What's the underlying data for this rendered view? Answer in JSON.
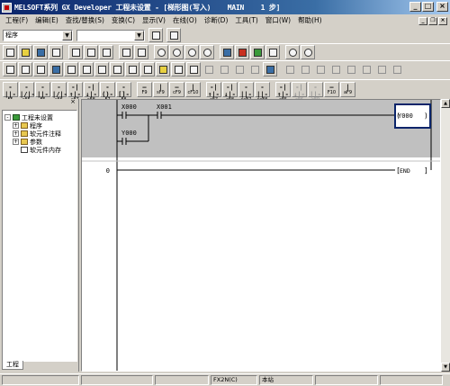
{
  "window": {
    "title": "MELSOFT系列 GX Developer 工程未设置 - [梯形图(写入)    MAIN    1 步]",
    "min_label": "_",
    "max_label": "□",
    "close_label": "×"
  },
  "menu": {
    "items": [
      "工程(F)",
      "编辑(E)",
      "查找/替换(S)",
      "变换(C)",
      "显示(V)",
      "在线(O)",
      "诊断(D)",
      "工具(T)",
      "窗口(W)",
      "帮助(H)"
    ],
    "mdi_min": "_",
    "mdi_restore": "❐",
    "mdi_close": "×"
  },
  "combo": {
    "program_value": "程序",
    "second_value": "",
    "arrow": "▼"
  },
  "ladder_toolbar": [
    {
      "sym": "-||-",
      "fk": "F5",
      "enabled": true
    },
    {
      "sym": "-|/|-",
      "fk": "sF5",
      "enabled": true
    },
    {
      "sym": "-||-",
      "fk": "F6",
      "enabled": true
    },
    {
      "sym": "-|/|-",
      "fk": "sF6",
      "enabled": true
    },
    {
      "sym": "-|↑|-",
      "fk": "sF7",
      "enabled": true
    },
    {
      "sym": "-|↓|-",
      "fk": "sF8",
      "enabled": true
    },
    {
      "sym": "-()-",
      "fk": "F7",
      "enabled": true
    },
    {
      "sym": "-[]-",
      "fk": "F8",
      "enabled": true
    },
    {
      "sym": "—",
      "fk": "F9",
      "enabled": true
    },
    {
      "sym": "|",
      "fk": "sF9",
      "enabled": true
    },
    {
      "sym": "—",
      "fk": "cF9",
      "enabled": true
    },
    {
      "sym": "|",
      "fk": "cF10",
      "enabled": true
    },
    {
      "sym": "-|↑|-",
      "fk": "aF7",
      "enabled": true
    },
    {
      "sym": "-|↓|-",
      "fk": "aF8",
      "enabled": true
    },
    {
      "sym": "-||-",
      "fk": "saF7",
      "enabled": true
    },
    {
      "sym": "-||-",
      "fk": "saF8",
      "enabled": true
    },
    {
      "sym": "-|↑|-",
      "fk": "aF5",
      "enabled": true
    },
    {
      "sym": "-|↓|-",
      "fk": "aF6",
      "enabled": false
    },
    {
      "sym": "-||-",
      "fk": "aF9",
      "enabled": false
    },
    {
      "sym": "—",
      "fk": "F10",
      "enabled": true
    },
    {
      "sym": "|",
      "fk": "aF9",
      "enabled": true
    }
  ],
  "project_tree": {
    "close_label": "×",
    "items": [
      {
        "label": "工程未设置",
        "expander": "-",
        "icon": "project",
        "indent": 0
      },
      {
        "label": "程序",
        "expander": "+",
        "icon": "folder",
        "indent": 1
      },
      {
        "label": "软元件注释",
        "expander": "+",
        "icon": "folder",
        "indent": 1
      },
      {
        "label": "参数",
        "expander": "+",
        "icon": "folder",
        "indent": 1
      },
      {
        "label": "软元件内存",
        "expander": "",
        "icon": "doc",
        "indent": 1
      }
    ],
    "tab_label": "工程"
  },
  "ladder": {
    "contact1": "X000",
    "contact2": "X001",
    "contact3": "Y000",
    "coil": "Y000",
    "step_label": "0",
    "end_label": "END"
  },
  "statusbar": {
    "cells": [
      "",
      "",
      "",
      "FX2N(C)",
      "本站",
      "",
      ""
    ]
  }
}
